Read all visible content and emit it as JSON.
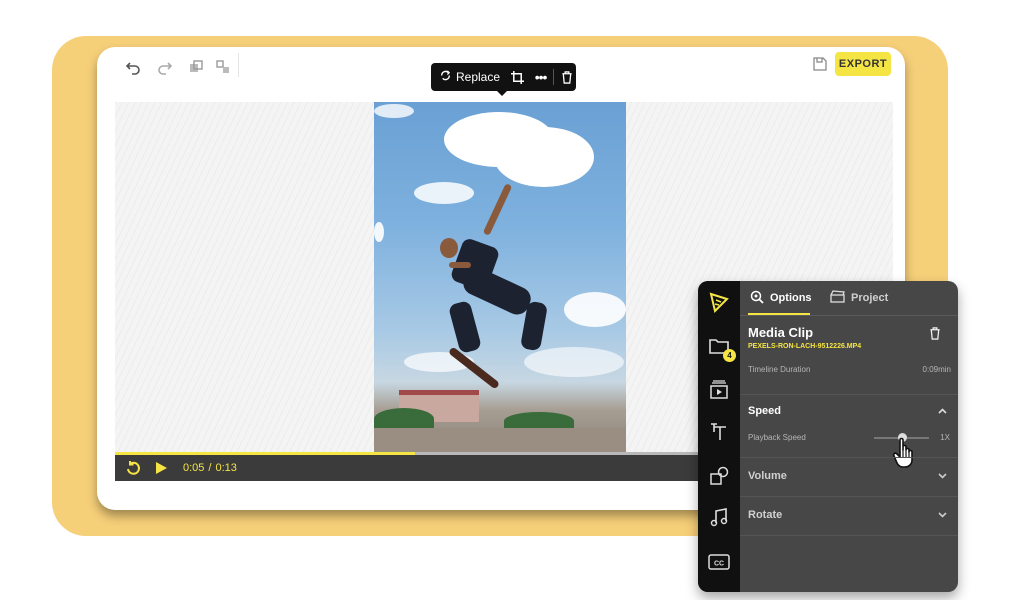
{
  "toolbar": {
    "replace_label": "Replace",
    "export_label": "EXPORT"
  },
  "player": {
    "current_time": "0:05",
    "time_separator": "/",
    "total_time": "0:13",
    "progress": 0.385
  },
  "panel": {
    "tabs": [
      {
        "label": "Options",
        "active": true
      },
      {
        "label": "Project",
        "active": false
      }
    ],
    "media_badge_count": "4",
    "clip": {
      "title": "Media Clip",
      "filename": "PEXELS-RON-LACH-9512226.MP4",
      "duration_label": "Timeline Duration",
      "duration_value": "0:09min"
    },
    "speed": {
      "title": "Speed",
      "playback_label": "Playback Speed",
      "playback_value": "1X",
      "slider_level": 0.5
    },
    "volume": {
      "title": "Volume"
    },
    "rotate": {
      "title": "Rotate"
    }
  },
  "colors": {
    "accent": "#f5e544",
    "backdrop": "#f6cf79",
    "panel_bg": "#474747",
    "rail_bg": "#101010"
  },
  "icons": [
    "undo-icon",
    "redo-icon",
    "duplicate-icon",
    "group-icon",
    "save-icon",
    "replace-icon",
    "crop-icon",
    "more-icon",
    "delete-icon",
    "restart-icon",
    "play-icon",
    "clip-edit-icon",
    "folder-icon",
    "media-library-icon",
    "text-icon",
    "shapes-icon",
    "music-icon",
    "captions-icon",
    "options-icon",
    "project-icon",
    "trash-icon",
    "chevron-up-icon",
    "chevron-down-icon",
    "hand-cursor-icon"
  ]
}
